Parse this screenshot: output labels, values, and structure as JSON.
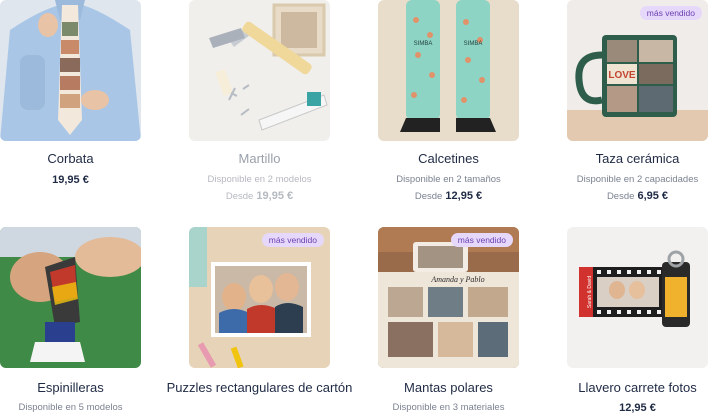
{
  "products": [
    {
      "name": "Corbata",
      "price": "19,95 €"
    },
    {
      "name": "Martillo",
      "availability": "Disponible en 2 modelos",
      "from_label": "Desde",
      "price": "19,95 €"
    },
    {
      "name": "Calcetines",
      "availability": "Disponible en 2 tamaños",
      "from_label": "Desde",
      "price": "12,95 €"
    },
    {
      "name": "Taza cerámica",
      "availability": "Disponible en 2 capacidades",
      "from_label": "Desde",
      "price": "6,95 €",
      "badge": "más vendido"
    },
    {
      "name": "Espinilleras",
      "availability": "Disponible en 5 modelos"
    },
    {
      "name": "Puzzles rectangulares de cartón",
      "badge": "más vendido"
    },
    {
      "name": "Mantas polares",
      "availability": "Disponible en 3 materiales",
      "badge": "más vendido"
    },
    {
      "name": "Llavero carrete fotos",
      "price": "12,95 €"
    }
  ],
  "image_text": {
    "socks_name": "SIMBA",
    "mug_word": "LOVE",
    "blanket_text": "Amanda y Pablo",
    "keychain_text": "Sarah & David"
  },
  "colors": {
    "badge_bg": "#e6d8fb",
    "badge_text": "#6a3fb0",
    "title": "#1f2a44"
  }
}
